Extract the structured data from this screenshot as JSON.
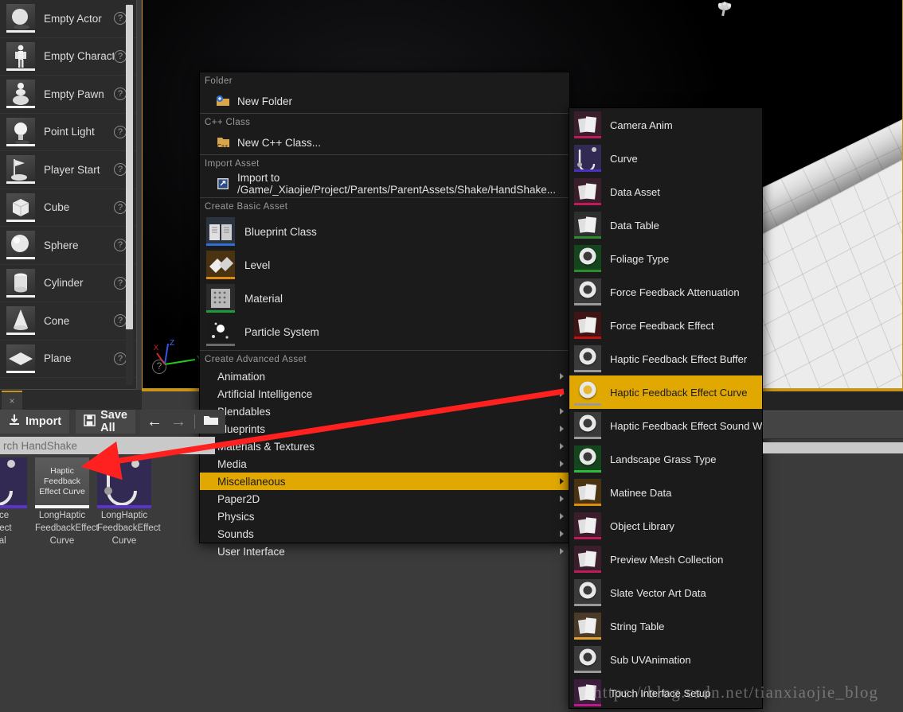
{
  "placement_panel": {
    "items": [
      {
        "label": "Empty Actor",
        "icon": "sphere-actor-icon"
      },
      {
        "label": "Empty Charact",
        "icon": "character-icon"
      },
      {
        "label": "Empty Pawn",
        "icon": "pawn-icon"
      },
      {
        "label": "Point Light",
        "icon": "light-bulb-icon"
      },
      {
        "label": "Player Start",
        "icon": "player-start-icon"
      },
      {
        "label": "Cube",
        "icon": "cube-icon"
      },
      {
        "label": "Sphere",
        "icon": "sphere-icon"
      },
      {
        "label": "Cylinder",
        "icon": "cylinder-icon"
      },
      {
        "label": "Cone",
        "icon": "cone-icon"
      },
      {
        "label": "Plane",
        "icon": "plane-icon"
      }
    ],
    "help_glyph": "?"
  },
  "viewport": {
    "axis_x": "X",
    "axis_y": "Y",
    "axis_z": "Z",
    "help_glyph": "?"
  },
  "context_menu": {
    "sections": [
      {
        "heading": "Folder",
        "rows": [
          {
            "label": "New Folder",
            "icon": "new-folder-icon"
          }
        ]
      },
      {
        "heading": "C++ Class",
        "rows": [
          {
            "label": "New C++ Class...",
            "icon": "cpp-class-icon"
          }
        ]
      },
      {
        "heading": "Import Asset",
        "rows": [
          {
            "label": "Import to /Game/_Xiaojie/Project/Parents/ParentAssets/Shake/HandShake...",
            "icon": "import-icon"
          }
        ]
      }
    ],
    "basic_heading": "Create Basic Asset",
    "basic_items": [
      {
        "label": "Blueprint Class",
        "icon": "blueprint-class-icon",
        "accent": "#2f6fd0"
      },
      {
        "label": "Level",
        "icon": "level-icon",
        "accent": "#e08b10"
      },
      {
        "label": "Material",
        "icon": "material-icon",
        "accent": "#1d9b3c"
      },
      {
        "label": "Particle System",
        "icon": "particle-system-icon",
        "accent": "#6a6a6a"
      }
    ],
    "advanced_heading": "Create Advanced Asset",
    "advanced_items": [
      {
        "label": "Animation",
        "active": false
      },
      {
        "label": "Artificial Intelligence",
        "active": false
      },
      {
        "label": "Blendables",
        "active": false
      },
      {
        "label": "Blueprints",
        "active": false
      },
      {
        "label": "Materials & Textures",
        "active": false
      },
      {
        "label": "Media",
        "active": false
      },
      {
        "label": "Miscellaneous",
        "active": true
      },
      {
        "label": "Paper2D",
        "active": false
      },
      {
        "label": "Physics",
        "active": false
      },
      {
        "label": "Sounds",
        "active": false
      },
      {
        "label": "User Interface",
        "active": false
      }
    ]
  },
  "submenu": {
    "items": [
      {
        "label": "Camera Anim",
        "icon": "camera-anim-icon",
        "accent": "#c01a5a",
        "bg": "#3b1e2c",
        "kind": "img"
      },
      {
        "label": "Curve",
        "icon": "curve-icon",
        "accent": "#4b2fc0",
        "bg": "#322a52",
        "kind": "curve"
      },
      {
        "label": "Data Asset",
        "icon": "data-asset-icon",
        "accent": "#c01a5a",
        "bg": "#3b1e2c",
        "kind": "img"
      },
      {
        "label": "Data Table",
        "icon": "data-table-icon",
        "accent": "#2d8c2d",
        "bg": "#2e2e2e",
        "kind": "img"
      },
      {
        "label": "Foliage Type",
        "icon": "foliage-type-icon",
        "accent": "#2d8c2d",
        "bg": "#14451c",
        "kind": "ring"
      },
      {
        "label": "Force Feedback Attenuation",
        "icon": "force-feedback-attenuation-icon",
        "accent": "#9a9a9a",
        "bg": "#3a3a3a",
        "kind": "ring"
      },
      {
        "label": "Force Feedback Effect",
        "icon": "force-feedback-effect-icon",
        "accent": "#c01010",
        "bg": "#3f1414",
        "kind": "img"
      },
      {
        "label": "Haptic Feedback Effect Buffer",
        "icon": "haptic-feedback-effect-buffer-icon",
        "accent": "#9a9a9a",
        "bg": "#3a3a3a",
        "kind": "ring"
      },
      {
        "label": "Haptic Feedback Effect Curve",
        "icon": "haptic-feedback-effect-curve-icon",
        "accent": "#9a9a9a",
        "bg": "#e0a800",
        "kind": "ring-gold",
        "active": true
      },
      {
        "label": "Haptic Feedback Effect Sound Wave",
        "icon": "haptic-feedback-effect-sound-wave-icon",
        "accent": "#9a9a9a",
        "bg": "#3a3a3a",
        "kind": "ring"
      },
      {
        "label": "Landscape Grass Type",
        "icon": "landscape-grass-type-icon",
        "accent": "#2fbb3a",
        "bg": "#14451c",
        "kind": "ring"
      },
      {
        "label": "Matinee Data",
        "icon": "matinee-data-icon",
        "accent": "#e08b10",
        "bg": "#4a3310",
        "kind": "img"
      },
      {
        "label": "Object Library",
        "icon": "object-library-icon",
        "accent": "#c01a5a",
        "bg": "#3b1e2c",
        "kind": "img"
      },
      {
        "label": "Preview Mesh Collection",
        "icon": "preview-mesh-collection-icon",
        "accent": "#c01a5a",
        "bg": "#3b1e2c",
        "kind": "img"
      },
      {
        "label": "Slate Vector Art Data",
        "icon": "slate-vector-art-data-icon",
        "accent": "#9a9a9a",
        "bg": "#3a3a3a",
        "kind": "ring"
      },
      {
        "label": "String Table",
        "icon": "string-table-icon",
        "accent": "#e0a030",
        "bg": "#4a3a28",
        "kind": "img"
      },
      {
        "label": "Sub UVAnimation",
        "icon": "sub-uv-animation-icon",
        "accent": "#9a9a9a",
        "bg": "#3a3a3a",
        "kind": "ring"
      },
      {
        "label": "Touch Interface Setup",
        "icon": "touch-interface-setup-icon",
        "accent": "#c01a8a",
        "bg": "#3b1e3c",
        "kind": "img"
      }
    ]
  },
  "content_browser": {
    "tab_close_glyph": "×",
    "toolbar": {
      "import_label": "Import",
      "save_all_label": "Save All",
      "back_glyph": "←",
      "forward_glyph": "→",
      "folder_glyph": "📁"
    },
    "search_placeholder": "rch HandShake",
    "assets": [
      {
        "name_lines": [
          "orce",
          "Effect",
          "nal"
        ],
        "thumb_kind": "curve",
        "selected": false
      },
      {
        "thumb_text": "Haptic\nFeedback\nEffect Curve",
        "name_lines": [
          "LongHaptic",
          "FeedbackEffect",
          "Curve"
        ],
        "thumb_kind": "text",
        "selected": true
      },
      {
        "name_lines": [
          "LongHaptic",
          "FeedbackEffect",
          "Curve"
        ],
        "thumb_kind": "curve",
        "selected": false
      }
    ]
  },
  "annotation": {
    "arrow_color": "#ff2020"
  },
  "watermark": {
    "text": "https://blog.csdn.net/tianxiaojie_blog"
  }
}
